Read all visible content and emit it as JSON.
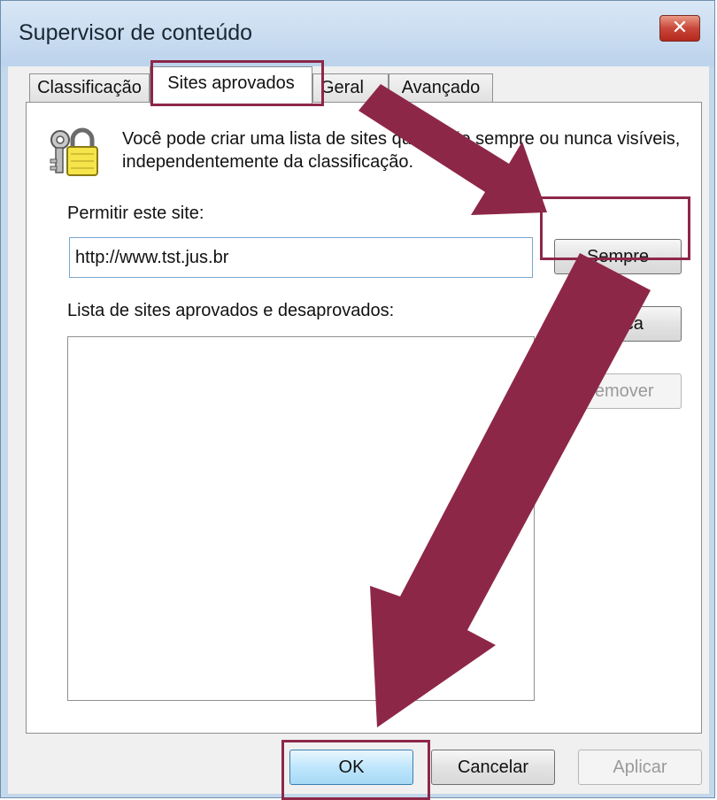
{
  "window": {
    "title": "Supervisor de conteúdo",
    "close_glyph": "✕"
  },
  "tabs": [
    {
      "label": "Classificação",
      "active": false
    },
    {
      "label": "Sites aprovados",
      "active": true
    },
    {
      "label": "Geral",
      "active": false
    },
    {
      "label": "Avançado",
      "active": false
    }
  ],
  "panel": {
    "description": "Você pode criar uma lista de sites que serão sempre ou nunca visíveis, independentemente da classificação.",
    "allow_label": "Permitir este site:",
    "url_value": "http://www.tst.jus.br",
    "list_label": "Lista de sites aprovados e desaprovados:",
    "list_items": [],
    "icon": "keys-lock-icon"
  },
  "side_buttons": {
    "always": "Sempre",
    "never": "Nunca",
    "remove": "Remover"
  },
  "footer": {
    "ok": "OK",
    "cancel": "Cancelar",
    "apply": "Aplicar"
  },
  "annotation_color": "#8d2748"
}
